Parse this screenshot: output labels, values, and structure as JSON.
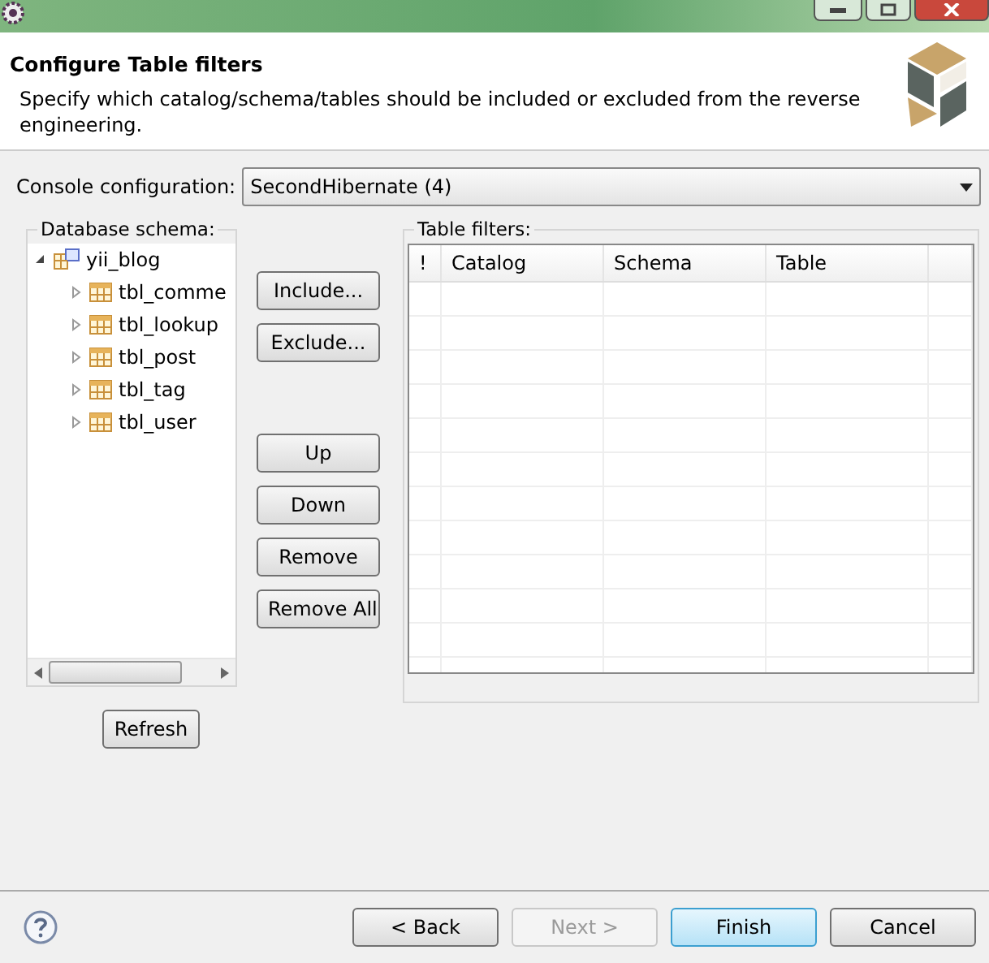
{
  "header": {
    "title": "Configure Table filters",
    "description": "Specify which catalog/schema/tables should be included or excluded from the reverse engineering."
  },
  "console": {
    "label": "Console configuration:",
    "value": "SecondHibernate (4)"
  },
  "schema": {
    "label": "Database schema:",
    "tree": [
      {
        "label": "yii_blog",
        "kind": "schema",
        "expanded": true,
        "children": [
          {
            "label": "tbl_comme",
            "kind": "table",
            "expanded": false
          },
          {
            "label": "tbl_lookup",
            "kind": "table",
            "expanded": false
          },
          {
            "label": "tbl_post",
            "kind": "table",
            "expanded": false
          },
          {
            "label": "tbl_tag",
            "kind": "table",
            "expanded": false
          },
          {
            "label": "tbl_user",
            "kind": "table",
            "expanded": false
          }
        ]
      }
    ],
    "refresh": "Refresh"
  },
  "action_groups": [
    [
      "Include...",
      "Exclude..."
    ],
    [
      "Up",
      "Down",
      "Remove",
      "Remove All"
    ]
  ],
  "filters": {
    "label": "Table filters:",
    "columns": [
      "!",
      "Catalog",
      "Schema",
      "Table"
    ]
  },
  "footer": [
    {
      "label": "< Back",
      "disabled": false,
      "default": false
    },
    {
      "label": "Next >",
      "disabled": true,
      "default": false
    },
    {
      "label": "Finish",
      "disabled": false,
      "default": true
    },
    {
      "label": "Cancel",
      "disabled": false,
      "default": false
    }
  ]
}
